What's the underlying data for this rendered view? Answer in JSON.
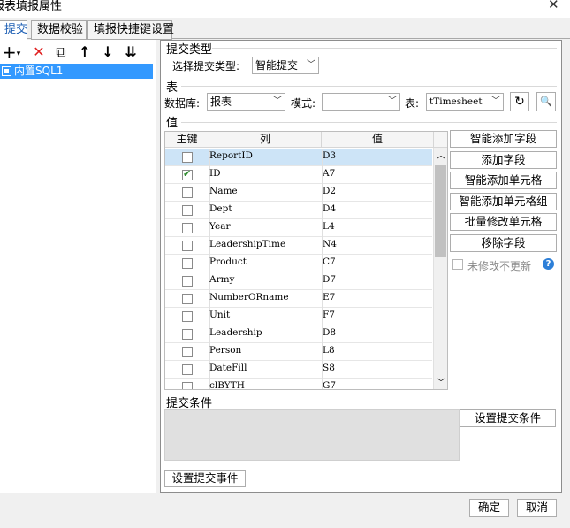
{
  "window": {
    "title": "报表填报属性",
    "close_glyph": "✕"
  },
  "tabs": [
    {
      "label": "提交",
      "active": true
    },
    {
      "label": "数据校验",
      "active": false
    },
    {
      "label": "填报快捷键设置",
      "active": false
    }
  ],
  "left_toolbar": {
    "icons": [
      "add-icon",
      "delete-icon",
      "copy-icon",
      "move-up-icon",
      "move-down-icon",
      "move-bottom-icon"
    ],
    "glyphs": {
      "add": "+",
      "add_dropdown": "▾",
      "delete": "✕",
      "copy": "⧉",
      "up": "↑",
      "down": "↓",
      "bottom": "⇊"
    }
  },
  "tree": {
    "item": "内置SQL1"
  },
  "submit_type": {
    "section": "提交类型",
    "label": "选择提交类型:",
    "value": "智能提交"
  },
  "table_section": {
    "section": "表",
    "db_label": "数据库:",
    "db_value": "报表",
    "mode_label": "模式:",
    "mode_value": "",
    "table_label": "表:",
    "table_value": "tTimesheet",
    "refresh_glyph": "↻",
    "preview_glyph": "🔍"
  },
  "value_section": {
    "section": "值",
    "columns": [
      "主键",
      "列",
      "值"
    ],
    "rows": [
      {
        "key": false,
        "col": "ReportID",
        "val": "D3",
        "selected": true
      },
      {
        "key": true,
        "col": "ID",
        "val": "A7",
        "selected": false
      },
      {
        "key": false,
        "col": "Name",
        "val": "D2",
        "selected": false
      },
      {
        "key": false,
        "col": "Dept",
        "val": "D4",
        "selected": false
      },
      {
        "key": false,
        "col": "Year",
        "val": "L4",
        "selected": false
      },
      {
        "key": false,
        "col": "LeadershipTime",
        "val": "N4",
        "selected": false
      },
      {
        "key": false,
        "col": "Product",
        "val": "C7",
        "selected": false
      },
      {
        "key": false,
        "col": "Army",
        "val": "D7",
        "selected": false
      },
      {
        "key": false,
        "col": "NumberORname",
        "val": "E7",
        "selected": false
      },
      {
        "key": false,
        "col": "Unit",
        "val": "F7",
        "selected": false
      },
      {
        "key": false,
        "col": "Leadership",
        "val": "D8",
        "selected": false
      },
      {
        "key": false,
        "col": "Person",
        "val": "L8",
        "selected": false
      },
      {
        "key": false,
        "col": "DateFill",
        "val": "S8",
        "selected": false
      },
      {
        "key": false,
        "col": "clBYTH",
        "val": "G7",
        "selected": false
      }
    ],
    "buttons": [
      "智能添加字段",
      "添加字段",
      "智能添加单元格",
      "智能添加单元格组",
      "批量修改单元格",
      "移除字段"
    ],
    "unchanged_label": "未修改不更新",
    "help_glyph": "?"
  },
  "submit_condition": {
    "section": "提交条件",
    "button": "设置提交条件"
  },
  "submit_event_button": "设置提交事件",
  "footer": {
    "ok": "确定",
    "cancel": "取消"
  }
}
